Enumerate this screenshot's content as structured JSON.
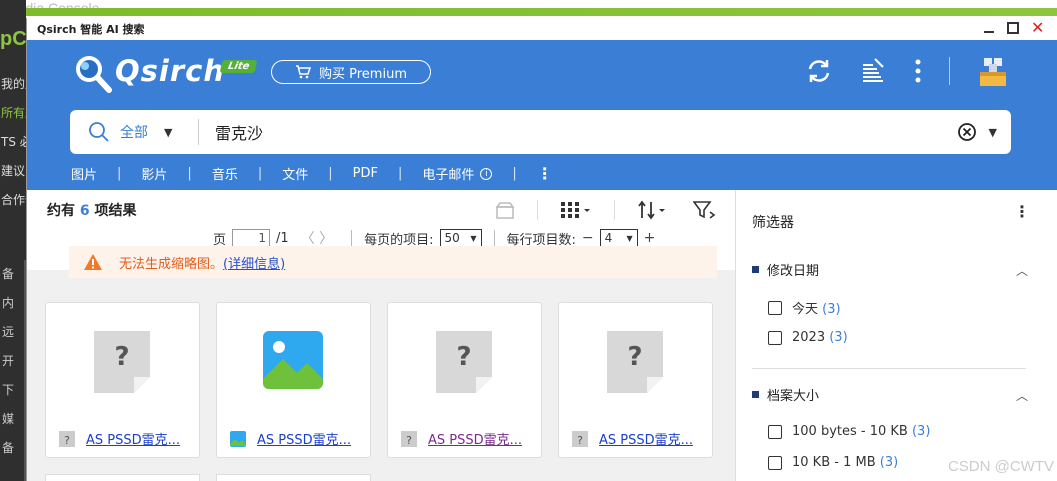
{
  "background_app": {
    "title": "media Console",
    "logo": "pC",
    "menu": [
      "我的应",
      "所有应",
      "TS 必",
      "建议",
      "合作伙"
    ],
    "icons": [
      "备",
      "内",
      "远",
      "开",
      "下",
      "媒",
      "备"
    ]
  },
  "window": {
    "title": "Qsirch 智能 AI 搜索"
  },
  "header": {
    "brand": "Qsirch",
    "badge": "Lite",
    "premium_label": "购买 Premium"
  },
  "search": {
    "scope": "全部",
    "query": "雷克沙"
  },
  "categories": [
    "图片",
    "影片",
    "音乐",
    "文件",
    "PDF",
    "电子邮件"
  ],
  "results": {
    "count_prefix": "约有",
    "count": "6",
    "count_suffix": "项结果",
    "page_label": "页",
    "page_value": "1",
    "page_total": "/1",
    "per_page_label": "每页的项目:",
    "per_page_value": "50",
    "per_row_label": "每行项目数:",
    "per_row_value": "4",
    "minus": "−",
    "plus": "+"
  },
  "warning": {
    "text": "无法生成缩略图。",
    "link": "(详细信息)"
  },
  "cards": [
    {
      "name": "AS PSSD雷克...",
      "kind": "unknown",
      "visited": false
    },
    {
      "name": "AS PSSD雷克...",
      "kind": "image",
      "visited": false
    },
    {
      "name": "AS PSSD雷克...",
      "kind": "unknown",
      "visited": true
    },
    {
      "name": "AS PSSD雷克...",
      "kind": "unknown",
      "visited": false
    }
  ],
  "filter": {
    "title": "筛选器",
    "sections": [
      {
        "label": "修改日期",
        "items": [
          {
            "label": "今天",
            "count": "(3)"
          },
          {
            "label": "2023",
            "count": "(3)"
          }
        ]
      },
      {
        "label": "档案大小",
        "items": [
          {
            "label": "100 bytes - 10 KB",
            "count": "(3)"
          },
          {
            "label": "10 KB - 1 MB",
            "count": "(3)"
          }
        ]
      }
    ]
  },
  "watermark": "CSDN @CWTV",
  "colors": {
    "header_blue": "#3a7fd5",
    "accent_red": "#d32020",
    "warn_orange": "#e35d1b"
  }
}
